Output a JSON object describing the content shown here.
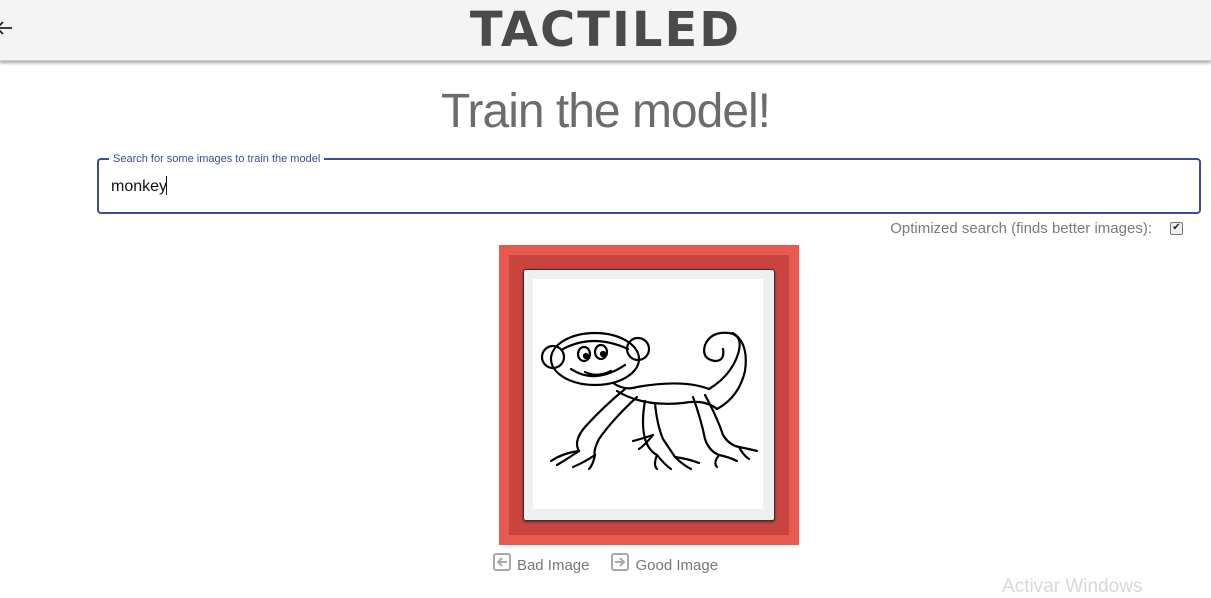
{
  "header": {
    "logo_text": "TACTILED",
    "back_icon": "arrow-left-icon"
  },
  "main": {
    "title": "Train the model!",
    "search": {
      "label": "Search for some images to train the model",
      "value": "monkey"
    },
    "optimized_search": {
      "label": "Optimized search (finds better images):",
      "checked": true
    },
    "image_card": {
      "description": "monkey line drawing",
      "colors": {
        "outer": "#e85a4f",
        "inner": "#c9433f"
      }
    },
    "actions": {
      "bad_label": "Bad Image",
      "bad_icon": "arrow-left-box-icon",
      "good_label": "Good Image",
      "good_icon": "arrow-right-box-icon"
    }
  },
  "overlay": {
    "watermark": "Activar Windows"
  }
}
